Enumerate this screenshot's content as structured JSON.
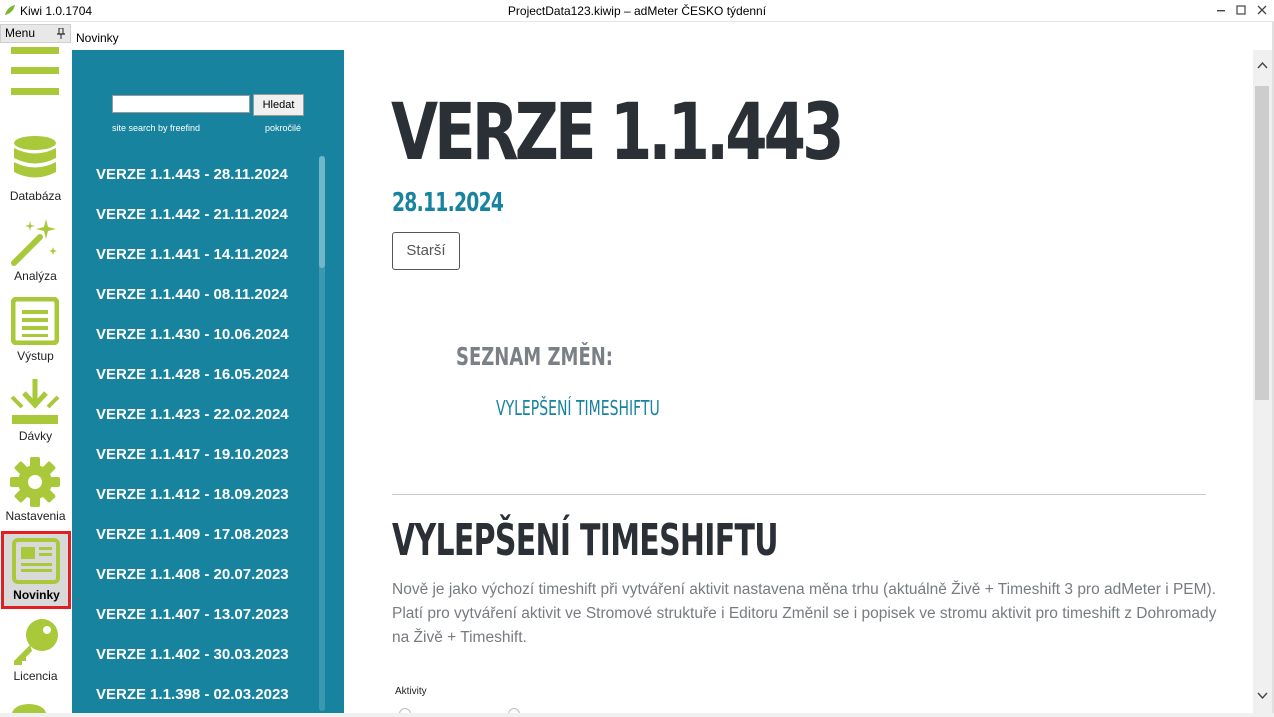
{
  "window": {
    "app_title": "Kiwi 1.0.1704",
    "doc_title": "ProjectData123.kiwip  –  adMeter ČESKO týdenní",
    "minimize": "▬",
    "maximize": "☐",
    "close": "✕"
  },
  "menu": {
    "label": "Menu",
    "pin": "📌"
  },
  "tab": {
    "label": "Novinky"
  },
  "sidebar": {
    "items": [
      {
        "label": "Databáza",
        "icon": "database-icon"
      },
      {
        "label": "Analýza",
        "icon": "magic-wand-icon"
      },
      {
        "label": "Výstup",
        "icon": "list-document-icon"
      },
      {
        "label": "Dávky",
        "icon": "download-tray-icon"
      },
      {
        "label": "Nastavenia",
        "icon": "gear-icon"
      },
      {
        "label": "Novinky",
        "icon": "newspaper-icon",
        "active": true
      },
      {
        "label": "Licencia",
        "icon": "key-icon"
      }
    ],
    "accent": "#a9c83a"
  },
  "news_panel": {
    "search_button": "Hledat",
    "search_placeholder": "",
    "search_note": "site search by freefind",
    "advanced": "pokročilé",
    "versions": [
      "VERZE 1.1.443 - 28.11.2024",
      "VERZE 1.1.442 - 21.11.2024",
      "VERZE 1.1.441 - 14.11.2024",
      "VERZE 1.1.440 - 08.11.2024",
      "VERZE 1.1.430 - 10.06.2024",
      "VERZE 1.1.428 - 16.05.2024",
      "VERZE 1.1.423 - 22.02.2024",
      "VERZE 1.1.417 - 19.10.2023",
      "VERZE 1.1.412 - 18.09.2023",
      "VERZE 1.1.409 - 17.08.2023",
      "VERZE 1.1.408 - 20.07.2023",
      "VERZE 1.1.407 - 13.07.2023",
      "VERZE 1.1.402 - 30.03.2023",
      "VERZE 1.1.398 - 02.03.2023"
    ],
    "background": "#17839e"
  },
  "content": {
    "title": "VERZE 1.1.443",
    "date": "28.11.2024",
    "older_button": "Starší",
    "changes_heading": "SEZNAM ZMĚN:",
    "changes_link": "VYLEPŠENÍ TIMESHIFTU",
    "section_heading": "VYLEPŠENÍ TIMESHIFTU",
    "section_text": "Nově je jako výchozí timeshift při vytváření aktivit nastavena měna trhu (aktuálně Živě + Timeshift 3 pro adMeter i PEM). Platí pro vytváření aktivit ve Stromové struktuře i Editoru Změnil se i popisek ve stromu aktivit pro timeshift z Dohromady na Živě + Timeshift.",
    "aktivity_label": "Aktivity"
  },
  "scrollbar": {
    "up": "︿",
    "down": "﹀"
  }
}
